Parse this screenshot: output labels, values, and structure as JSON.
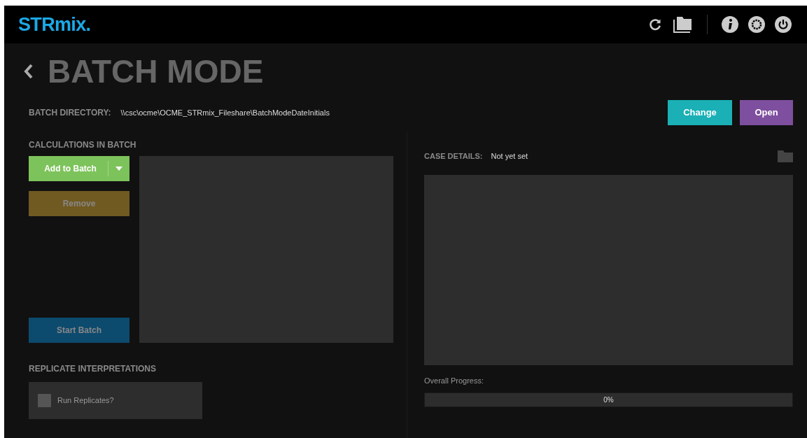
{
  "app": {
    "logo": "STRmix",
    "logo_mark": "."
  },
  "page": {
    "title": "BATCH MODE"
  },
  "batch_directory": {
    "label": "BATCH DIRECTORY:",
    "value": "\\\\csc\\ocme\\OCME_STRmix_Fileshare\\BatchModeDateInitials"
  },
  "directory_buttons": [
    {
      "label": "Change",
      "color": "#1ab0b5"
    },
    {
      "label": "Open",
      "color": "#7e4f9e"
    }
  ],
  "calculations": {
    "title": "CALCULATIONS IN BATCH",
    "buttons": [
      {
        "kind": "split",
        "label": "Add to Batch",
        "disabled": false
      },
      {
        "kind": "plain",
        "label": "Remove",
        "disabled": true
      },
      {
        "kind": "start",
        "label": "Start Batch",
        "disabled": true
      }
    ]
  },
  "replicates": {
    "title": "REPLICATE INTERPRETATIONS",
    "checkbox": {
      "label": "Run Replicates?",
      "checked": false
    }
  },
  "case_details": {
    "label": "CASE DETAILS:",
    "value": "Not yet set"
  },
  "progress": {
    "label": "Overall Progress:",
    "level": 0,
    "reading": "0%"
  }
}
